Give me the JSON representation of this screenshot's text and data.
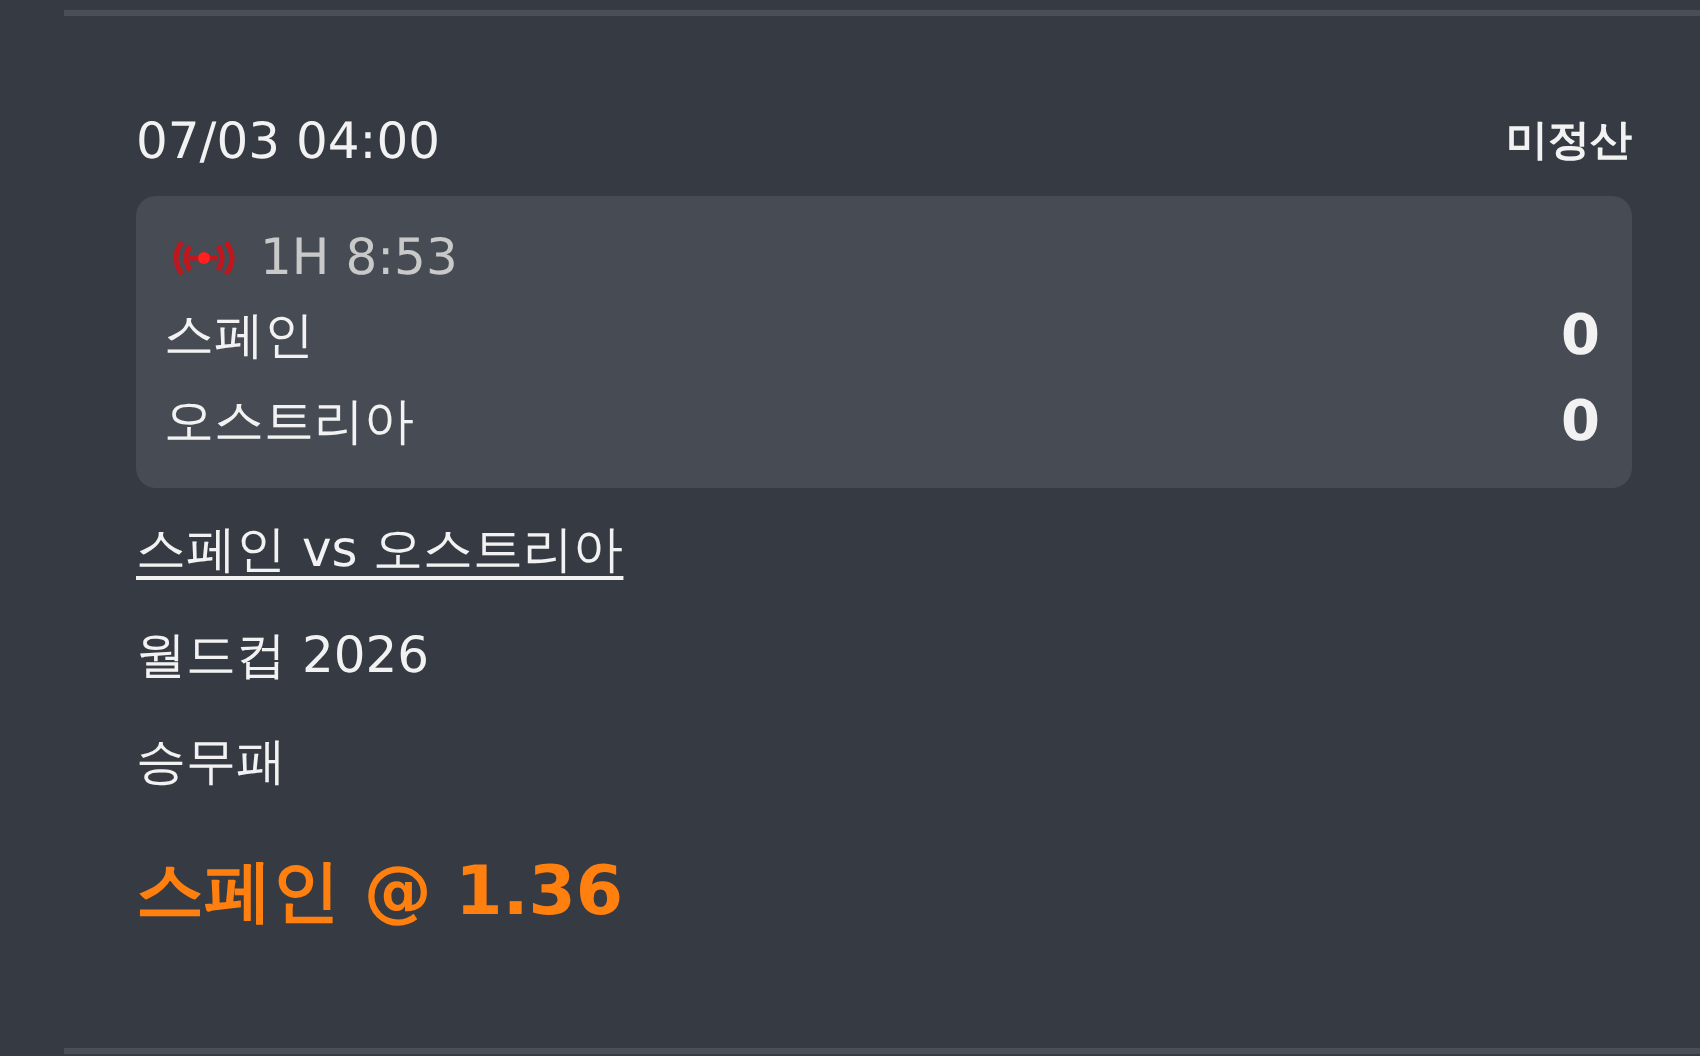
{
  "bet": {
    "datetime": "07/03 04:00",
    "status": "미정산",
    "live": {
      "period": "1H",
      "clock": "8:53"
    },
    "teams": [
      {
        "name": "스페인",
        "score": "0"
      },
      {
        "name": "오스트리아",
        "score": "0"
      }
    ],
    "match": "스페인 vs 오스트리아",
    "league": "월드컵 2026",
    "market": "승무패",
    "pick": "스페인 @ 1.36"
  }
}
